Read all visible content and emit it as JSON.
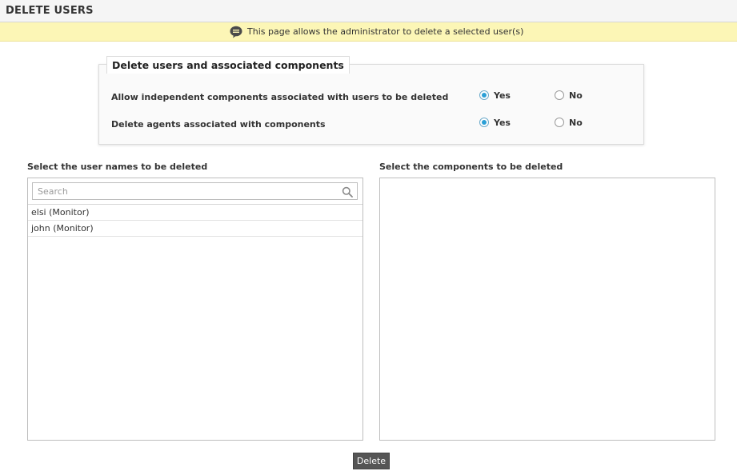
{
  "header": {
    "title": "DELETE USERS"
  },
  "banner": {
    "icon": "comment-icon",
    "text": "This page allows the administrator to delete a selected user(s)"
  },
  "options_panel": {
    "legend": "Delete users and associated components",
    "options": [
      {
        "label": "Allow independent components associated with users to be deleted",
        "yes_label": "Yes",
        "no_label": "No",
        "selected": "Yes"
      },
      {
        "label": "Delete agents associated with components",
        "yes_label": "Yes",
        "no_label": "No",
        "selected": "Yes"
      }
    ]
  },
  "users_panel": {
    "heading": "Select the user names to be deleted",
    "search": {
      "placeholder": "Search",
      "value": ""
    },
    "items": [
      {
        "label": "elsi (Monitor)"
      },
      {
        "label": "john (Monitor)"
      }
    ]
  },
  "components_panel": {
    "heading": "Select the components to be deleted",
    "items": []
  },
  "actions": {
    "delete_label": "Delete"
  },
  "colors": {
    "banner_bg": "#fcf6b6",
    "radio_accent": "#2a9fd6",
    "button_bg": "#555555"
  }
}
